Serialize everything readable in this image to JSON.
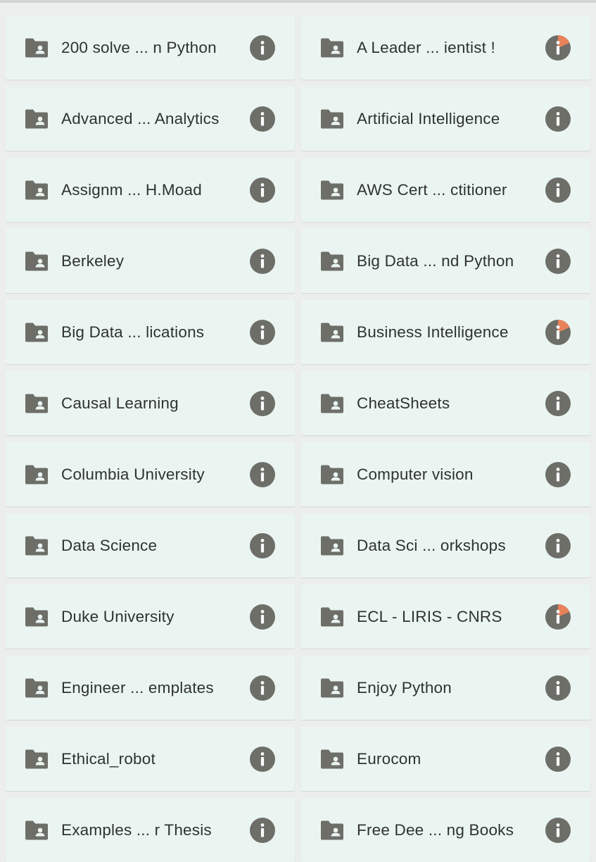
{
  "folders": [
    {
      "name": "200 solve ... n Python",
      "folder_icon": "shared-folder-icon",
      "info_icon": "info-icon",
      "badge": false
    },
    {
      "name": "A Leader ... ientist !",
      "folder_icon": "shared-folder-icon",
      "info_icon": "info-icon",
      "badge": true
    },
    {
      "name": "Advanced ... Analytics",
      "folder_icon": "shared-folder-icon",
      "info_icon": "info-icon",
      "badge": false
    },
    {
      "name": "Artificial Intelligence",
      "folder_icon": "shared-folder-icon",
      "info_icon": "info-icon",
      "badge": false
    },
    {
      "name": "Assignm ... H.Moad",
      "folder_icon": "shared-folder-icon",
      "info_icon": "info-icon",
      "badge": false
    },
    {
      "name": "AWS Cert ... ctitioner",
      "folder_icon": "shared-folder-icon",
      "info_icon": "info-icon",
      "badge": false
    },
    {
      "name": "Berkeley",
      "folder_icon": "shared-folder-icon",
      "info_icon": "info-icon",
      "badge": false
    },
    {
      "name": "Big Data ... nd Python",
      "folder_icon": "shared-folder-icon",
      "info_icon": "info-icon",
      "badge": false
    },
    {
      "name": "Big Data ... lications",
      "folder_icon": "shared-folder-icon",
      "info_icon": "info-icon",
      "badge": false
    },
    {
      "name": "Business Intelligence",
      "folder_icon": "shared-folder-icon",
      "info_icon": "info-icon",
      "badge": true
    },
    {
      "name": "Causal Learning",
      "folder_icon": "shared-folder-icon",
      "info_icon": "info-icon",
      "badge": false
    },
    {
      "name": "CheatSheets",
      "folder_icon": "shared-folder-icon",
      "info_icon": "info-icon",
      "badge": false
    },
    {
      "name": "Columbia University",
      "folder_icon": "shared-folder-icon",
      "info_icon": "info-icon",
      "badge": false
    },
    {
      "name": "Computer vision",
      "folder_icon": "shared-folder-icon",
      "info_icon": "info-icon",
      "badge": false
    },
    {
      "name": "Data Science",
      "folder_icon": "shared-folder-icon",
      "info_icon": "info-icon",
      "badge": false
    },
    {
      "name": "Data Sci ... orkshops",
      "folder_icon": "shared-folder-icon",
      "info_icon": "info-icon",
      "badge": false
    },
    {
      "name": "Duke University",
      "folder_icon": "shared-folder-icon",
      "info_icon": "info-icon",
      "badge": false
    },
    {
      "name": "ECL - LIRIS - CNRS",
      "folder_icon": "shared-folder-icon",
      "info_icon": "info-icon",
      "badge": true
    },
    {
      "name": "Engineer ... emplates",
      "folder_icon": "shared-folder-icon",
      "info_icon": "info-icon",
      "badge": false
    },
    {
      "name": "Enjoy Python",
      "folder_icon": "shared-folder-icon",
      "info_icon": "info-icon",
      "badge": false
    },
    {
      "name": "Ethical_robot",
      "folder_icon": "shared-folder-icon",
      "info_icon": "info-icon",
      "badge": false
    },
    {
      "name": "Eurocom",
      "folder_icon": "shared-folder-icon",
      "info_icon": "info-icon",
      "badge": false
    },
    {
      "name": "Examples ... r Thesis",
      "folder_icon": "shared-folder-icon",
      "info_icon": "info-icon",
      "badge": false
    },
    {
      "name": "Free Dee ... ng Books",
      "folder_icon": "shared-folder-icon",
      "info_icon": "info-icon",
      "badge": false
    }
  ],
  "colors": {
    "tile_background": "#eaf5f2",
    "icon_gray": "#6e6e68",
    "text": "#2f3230",
    "badge_accent": "#e8825a"
  }
}
